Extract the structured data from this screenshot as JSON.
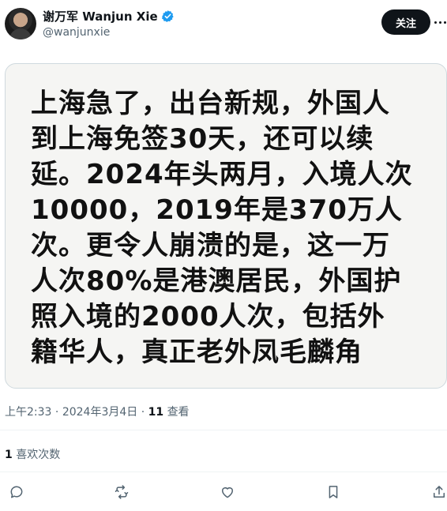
{
  "header": {
    "display_name": "谢万军 Wanjun Xie",
    "handle": "@wanjunxie",
    "follow_label": "关注"
  },
  "media": {
    "text": "上海急了，出台新规，外国人\n到上海免签30天，还可以续\n延。2024年头两月，入境人次\n10000，2019年是370万人\n次。更令人崩溃的是，这一万\n人次80%是港澳居民，外国护\n照入境的2000人次，包括外\n籍华人，真正老外凤毛麟角"
  },
  "meta": {
    "time": "上午2:33",
    "date": "2024年3月4日",
    "separator": "·",
    "views_count": "11",
    "views_label": "查看"
  },
  "likes": {
    "count": "1",
    "label": "喜欢次数"
  },
  "colors": {
    "accent": "#1d9bf0",
    "text": "#0f1419",
    "muted": "#536471"
  },
  "icons": [
    "reply-icon",
    "retweet-icon",
    "like-icon",
    "bookmark-icon",
    "share-icon",
    "verified-badge-icon",
    "more-icon"
  ]
}
